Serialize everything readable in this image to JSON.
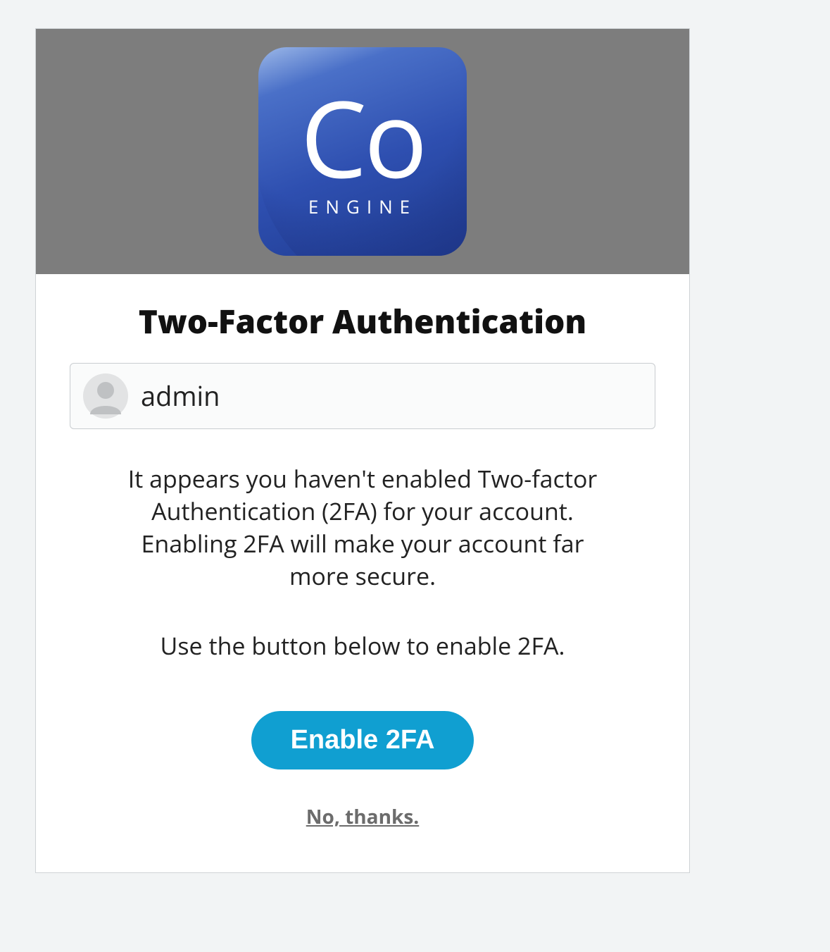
{
  "logo": {
    "symbol": "Co",
    "subtext": "ENGINE"
  },
  "header": {
    "title": "Two-Factor Authentication"
  },
  "user": {
    "name": "admin"
  },
  "body": {
    "description": "It appears you haven't enabled Two-factor Authentication (2FA) for your account. Enabling 2FA will make your account far more secure.",
    "instruction": "Use the button below to enable 2FA."
  },
  "actions": {
    "enable_label": "Enable 2FA",
    "decline_label": "No, thanks."
  }
}
